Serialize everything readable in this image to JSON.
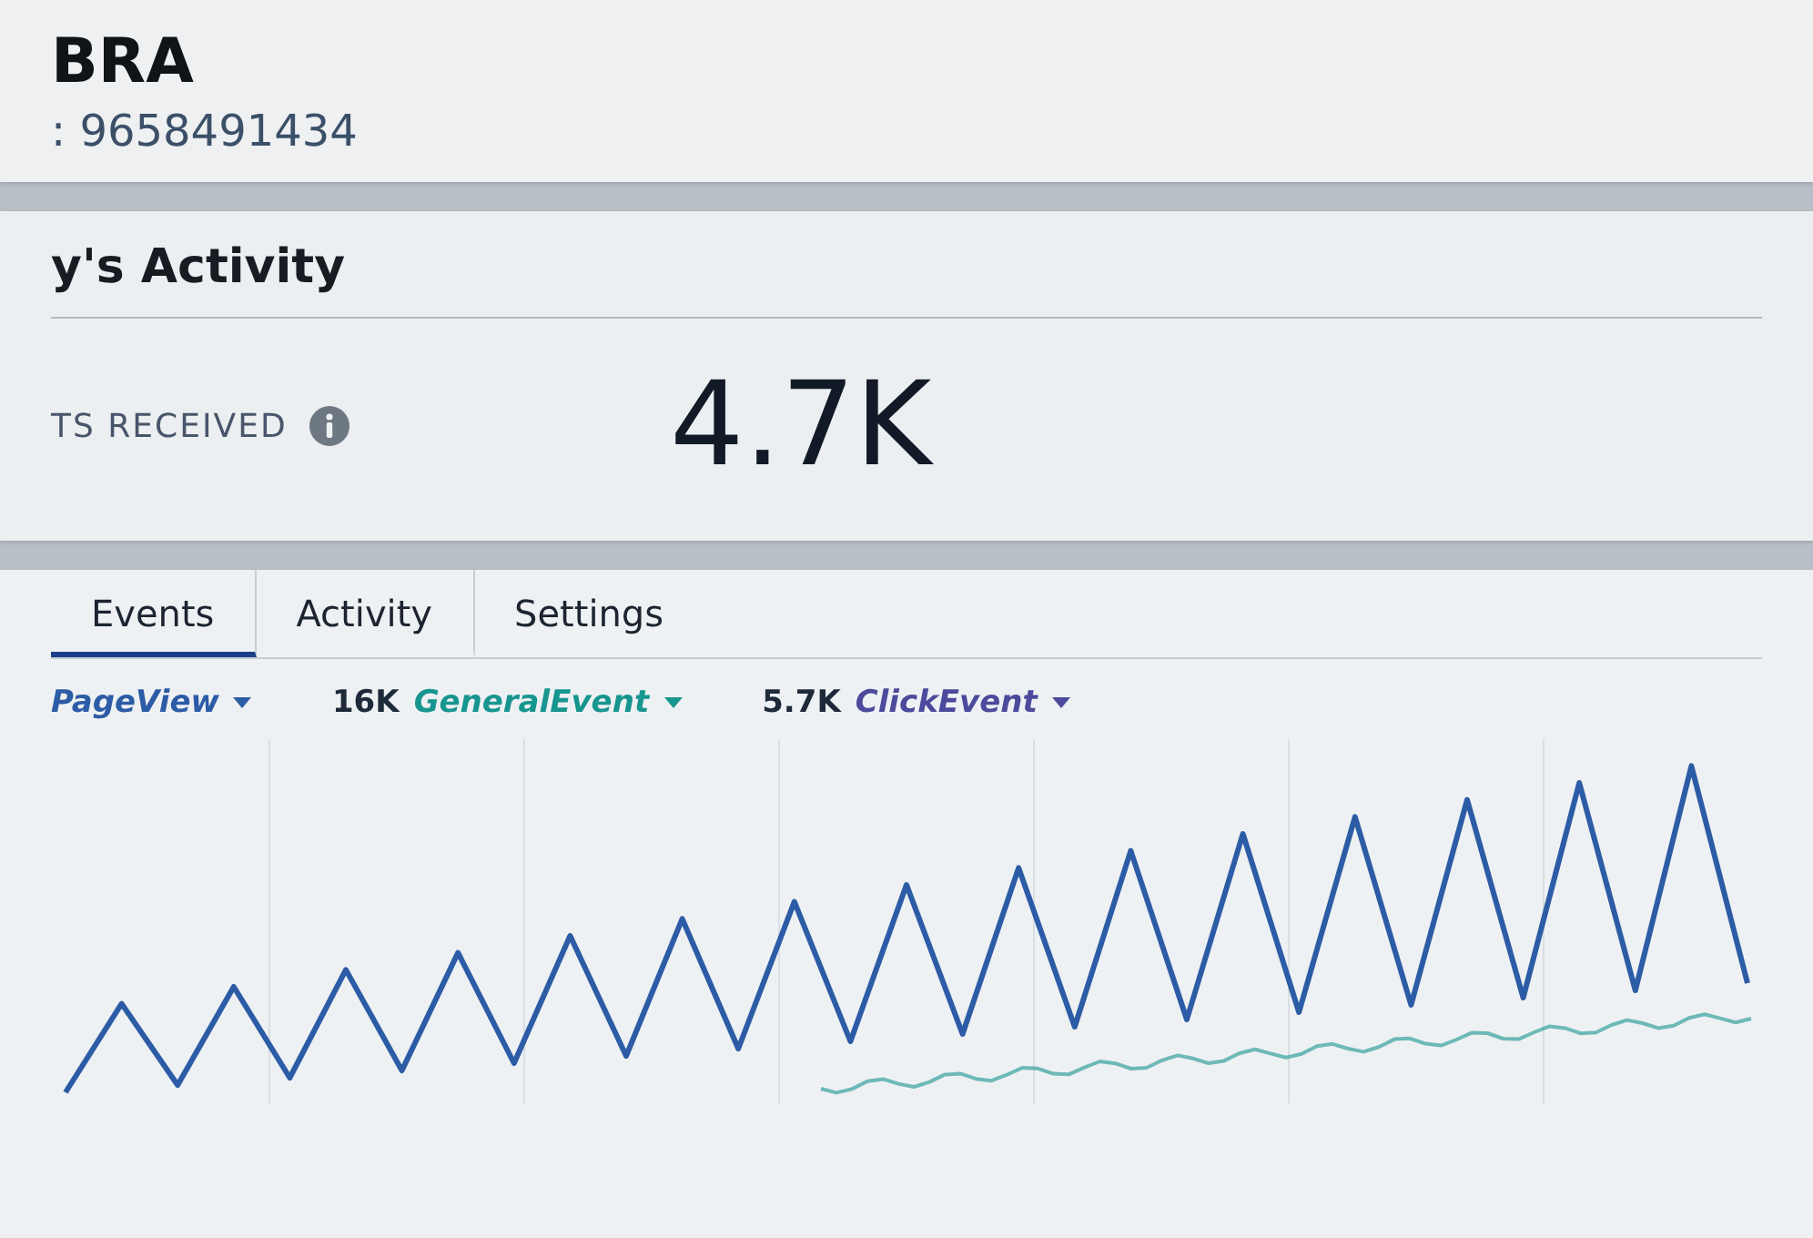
{
  "header": {
    "title": "BRA",
    "subtitle": ": 9658491434"
  },
  "activity": {
    "title": "y's Activity",
    "metric": {
      "label": "TS RECEIVED",
      "value": "4.7K"
    }
  },
  "tabs": [
    {
      "label": "Events",
      "selected": true
    },
    {
      "label": "Activity",
      "selected": false
    },
    {
      "label": "Settings",
      "selected": false
    }
  ],
  "legend": [
    {
      "name": "PageView",
      "color": "#2d5ca6"
    },
    {
      "count": "16K",
      "name": "GeneralEvent",
      "color": "#17958f"
    },
    {
      "count": "5.7K",
      "name": "ClickEvent",
      "color": "#4b4a9c"
    }
  ]
}
